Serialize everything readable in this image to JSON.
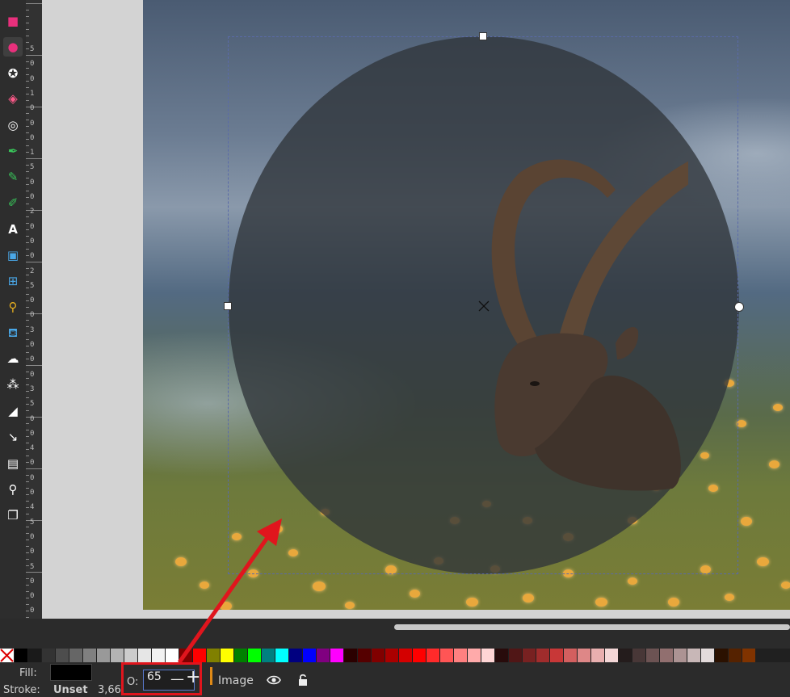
{
  "toolbox": {
    "tools": [
      {
        "name": "rectangle-tool-icon",
        "glyph": "■",
        "color": "#e8307c"
      },
      {
        "name": "ellipse-tool-icon",
        "glyph": "●",
        "color": "#e8307c"
      },
      {
        "name": "star-tool-icon",
        "glyph": "✪",
        "color": "#ffffff"
      },
      {
        "name": "3d-box-tool-icon",
        "glyph": "◈",
        "color": "#ff5a8a"
      },
      {
        "name": "spiral-tool-icon",
        "glyph": "◎",
        "color": "#ffffff"
      },
      {
        "name": "pen-tool-icon",
        "glyph": "✒",
        "color": "#39c45a"
      },
      {
        "name": "pencil-tool-icon",
        "glyph": "✎",
        "color": "#39c45a"
      },
      {
        "name": "calligraphy-tool-icon",
        "glyph": "✐",
        "color": "#39c45a"
      },
      {
        "name": "text-tool-icon",
        "glyph": "A",
        "color": "#ffffff"
      },
      {
        "name": "gradient-tool-icon",
        "glyph": "▣",
        "color": "#4aa8e8"
      },
      {
        "name": "mesh-tool-icon",
        "glyph": "⊞",
        "color": "#4aa8e8"
      },
      {
        "name": "dropper-tool-icon",
        "glyph": "⚲",
        "color": "#e8b020"
      },
      {
        "name": "paint-bucket-tool-icon",
        "glyph": "⛾",
        "color": "#4aa8e8"
      },
      {
        "name": "tweak-tool-icon",
        "glyph": "☁",
        "color": "#ffffff"
      },
      {
        "name": "spray-tool-icon",
        "glyph": "⁂",
        "color": "#ffffff"
      },
      {
        "name": "eraser-tool-icon",
        "glyph": "◢",
        "color": "#ffffff"
      },
      {
        "name": "connector-tool-icon",
        "glyph": "↘",
        "color": "#ffffff"
      },
      {
        "name": "pages-tool-icon",
        "glyph": "▤",
        "color": "#ffffff"
      },
      {
        "name": "zoom-tool-icon",
        "glyph": "⚲",
        "color": "#ffffff"
      },
      {
        "name": "clone-tool-icon",
        "glyph": "❐",
        "color": "#ffffff"
      }
    ]
  },
  "ruler": {
    "labels": [
      "5",
      "0",
      "0",
      "1",
      "0",
      "0",
      "0",
      "1",
      "5",
      "0",
      "0",
      "2",
      "0",
      "0",
      "0",
      "2",
      "5",
      "0",
      "0",
      "3",
      "0",
      "0",
      "0",
      "3",
      "5",
      "0",
      "0",
      "4",
      "0",
      "0",
      "0",
      "4",
      "5",
      "0",
      "0",
      "5",
      "0",
      "0",
      "0"
    ]
  },
  "canvas": {
    "object_type": "Image"
  },
  "palette": {
    "none_swatch": "none-color",
    "colors": [
      "#000000",
      "#1a1a1a",
      "#333333",
      "#4d4d4d",
      "#666666",
      "#808080",
      "#999999",
      "#b3b3b3",
      "#cccccc",
      "#e6e6e6",
      "#f2f2f2",
      "#ffffff",
      "#800000",
      "#ff0000",
      "#808000",
      "#ffff00",
      "#008000",
      "#00ff00",
      "#008080",
      "#00ffff",
      "#000080",
      "#0000ff",
      "#800080",
      "#ff00ff",
      "#2b0000",
      "#550000",
      "#800000",
      "#aa0000",
      "#d40000",
      "#ff0000",
      "#ff2a2a",
      "#ff5555",
      "#ff8080",
      "#ffaaaa",
      "#ffd5d5",
      "#280b0b",
      "#501616",
      "#782121",
      "#a02c2c",
      "#c83737",
      "#d35f5f",
      "#de8787",
      "#e9afaf",
      "#f4d7d7",
      "#241c1c",
      "#483737",
      "#6c5353",
      "#916f6f",
      "#ac9393",
      "#c8b7b7",
      "#e3dbdb",
      "#2b1100",
      "#552200",
      "#803300"
    ]
  },
  "status": {
    "fill_label": "Fill:",
    "stroke_label": "Stroke:",
    "stroke_value": "Unset",
    "stroke_width": "3,66",
    "fill_color": "#000000",
    "opacity_label": "O:",
    "opacity_value": "65",
    "minus": "—",
    "plus": "+",
    "layer_name": "Image",
    "visibility_icon": "eye-icon",
    "lock_icon": "unlock-icon"
  },
  "annotation": {
    "box_color": "#e0151d",
    "arrow_color": "#e0151d"
  }
}
